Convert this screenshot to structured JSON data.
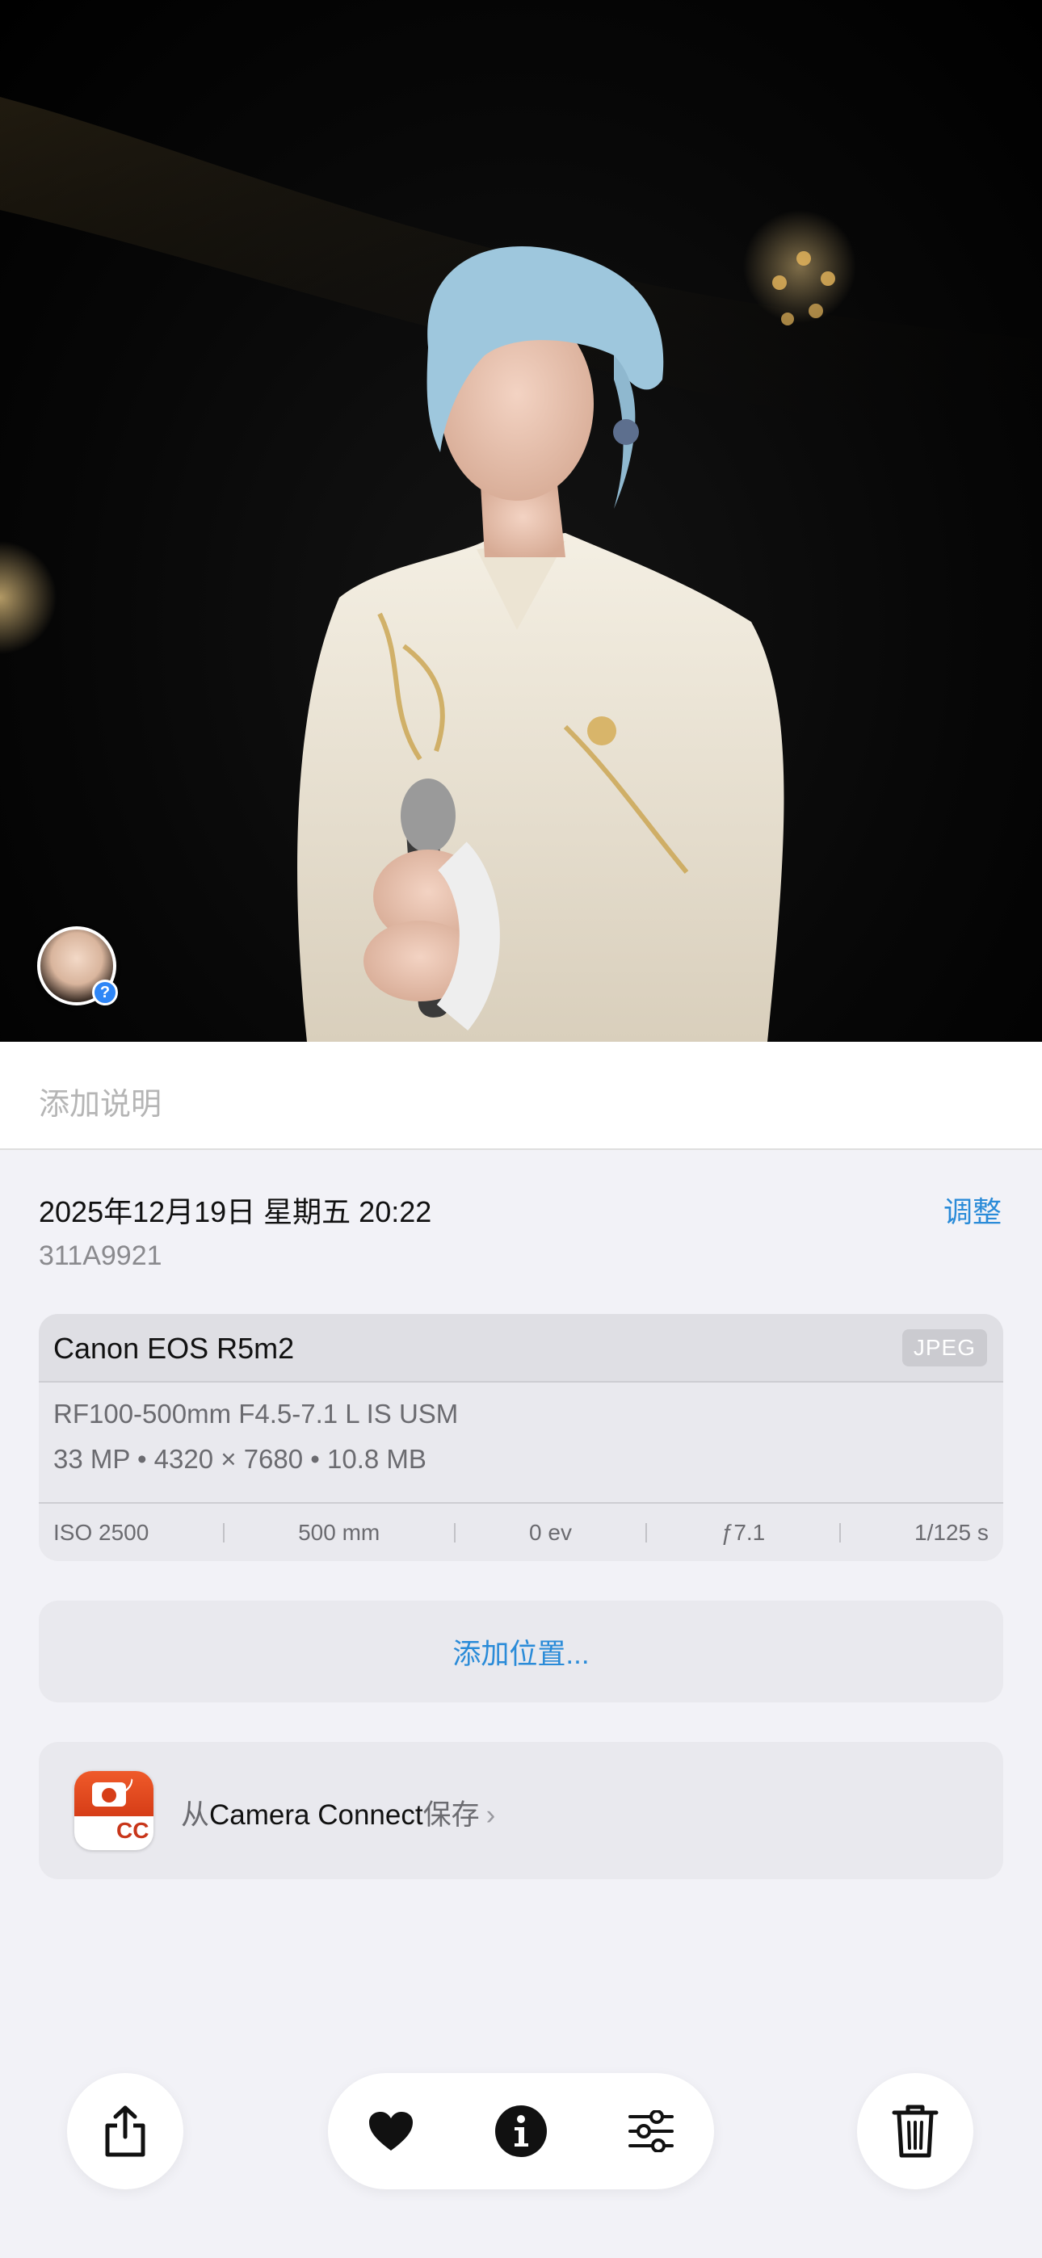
{
  "photo": {
    "description_icon": "concert-photo",
    "face_badge": "?"
  },
  "caption": {
    "placeholder": "添加说明"
  },
  "info": {
    "date": "2025年12月19日 星期五 20:22",
    "filename": "311A9921",
    "adjust_label": "调整"
  },
  "exif": {
    "camera": "Canon EOS R5m2",
    "format": "JPEG",
    "lens": "RF100-500mm F4.5-7.1 L IS USM",
    "specs": "33 MP  •  4320 × 7680  •  10.8 MB",
    "iso": "ISO 2500",
    "focal": "500 mm",
    "ev": "0 ev",
    "aperture": "ƒ7.1",
    "shutter": "1/125 s"
  },
  "location": {
    "label": "添加位置..."
  },
  "source": {
    "prefix": "从",
    "app": "Camera Connect",
    "suffix": "保存",
    "chevron": "›",
    "icon_label": "CC"
  },
  "toolbar": {
    "share_icon": "share-icon",
    "heart_icon": "heart-icon",
    "info_icon": "info-icon",
    "adjust_icon": "sliders-icon",
    "trash_icon": "trash-icon"
  },
  "colors": {
    "accent": "#2a8bd8",
    "background": "#f2f2f7",
    "card": "#e9e9ee"
  }
}
